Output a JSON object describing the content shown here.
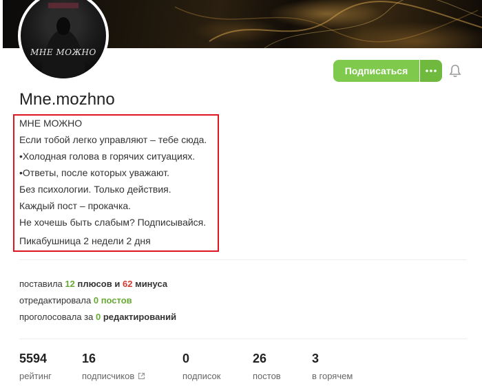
{
  "profile": {
    "avatar_text": "МНЕ МОЖНО",
    "username": "Mne.mozhno"
  },
  "actions": {
    "subscribe_label": "Подписаться",
    "more_icon": "ellipsis-icon",
    "bell_icon": "bell-icon"
  },
  "bio": {
    "lines": [
      "МНЕ МОЖНО",
      "Если тобой легко управляют – тебе сюда.",
      "•Холодная голова в горячих ситуациях.",
      "•Ответы, после которых уважают.",
      "Без психологии. Только действия.",
      "Каждый пост – прокачка.",
      "Не хочешь быть слабым? Подписывайся."
    ],
    "membership": "Пикабушница 2 недели 2 дня"
  },
  "activity": {
    "voted_prefix": "поставила",
    "pluses_count": "12",
    "pluses_label": "плюсов",
    "and_word": "и",
    "minuses_count": "62",
    "minuses_label": "минуса",
    "edited_prefix": "отредактировала",
    "edited_count": "0",
    "edited_label": "постов",
    "edit_votes_prefix": "проголосовала за",
    "edit_votes_count": "0",
    "edit_votes_label": "редактирований"
  },
  "metrics": [
    {
      "value": "5594",
      "label": "рейтинг"
    },
    {
      "value": "16",
      "label": "подписчиков"
    },
    {
      "value": "0",
      "label": "подписок"
    },
    {
      "value": "26",
      "label": "постов"
    },
    {
      "value": "3",
      "label": "в горячем"
    }
  ],
  "colors": {
    "accent_green": "#7fc94d",
    "minus_red": "#d03b2e",
    "highlight_border": "#e0141e"
  }
}
